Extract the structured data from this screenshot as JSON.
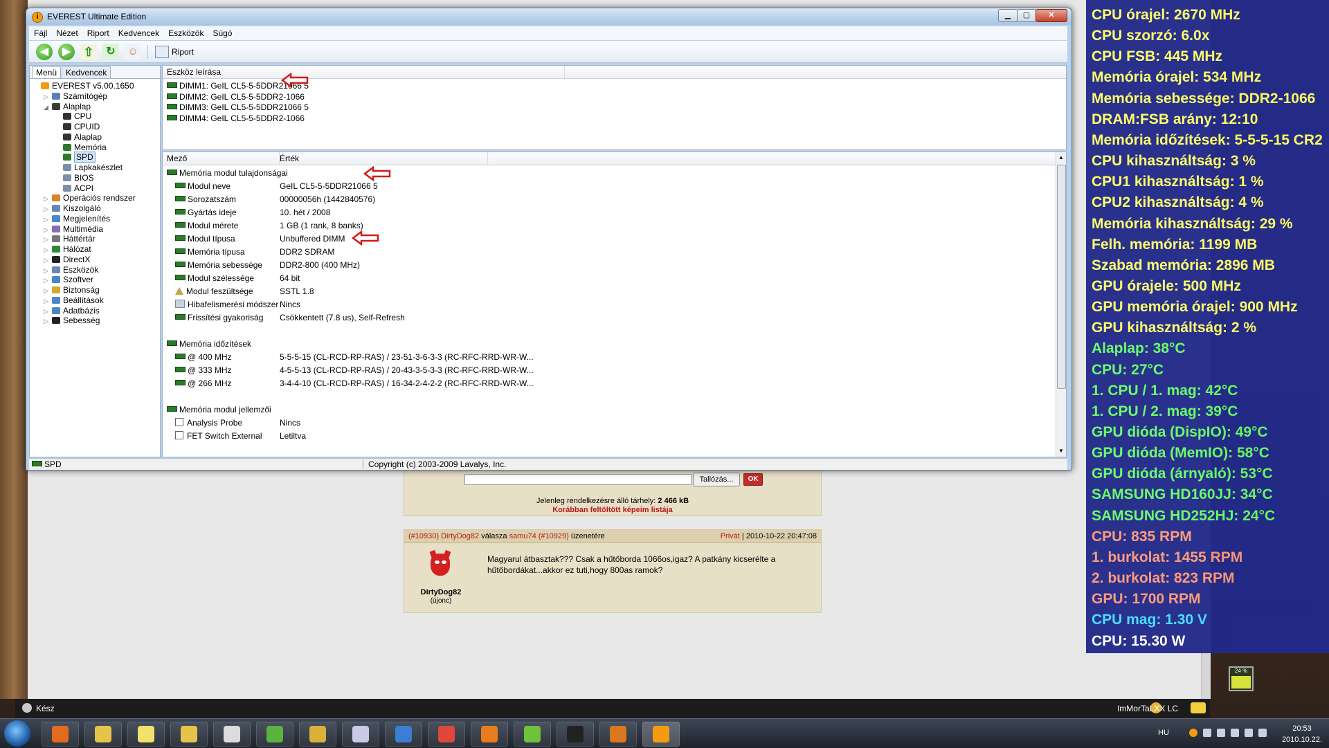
{
  "window": {
    "title": "EVEREST Ultimate Edition",
    "menu": [
      "Fájl",
      "Nézet",
      "Riport",
      "Kedvencek",
      "Eszközök",
      "Súgó"
    ],
    "toolbar": {
      "report_label": "Riport"
    }
  },
  "left_tabs": {
    "menu": "Menü",
    "favorites": "Kedvencek"
  },
  "tree": [
    {
      "label": "EVEREST v5.00.1650",
      "depth": 0,
      "expander": "",
      "icon": "everest-icon",
      "color": "#f39c12"
    },
    {
      "label": "Számítógép",
      "depth": 1,
      "expander": "▷",
      "icon": "computer-icon",
      "color": "#5a7fb8"
    },
    {
      "label": "Alaplap",
      "depth": 1,
      "expander": "◢",
      "icon": "motherboard-icon",
      "color": "#3b3b3b"
    },
    {
      "label": "CPU",
      "depth": 2,
      "expander": "",
      "icon": "cpu-icon",
      "color": "#333333"
    },
    {
      "label": "CPUID",
      "depth": 2,
      "expander": "",
      "icon": "cpuid-icon",
      "color": "#333333"
    },
    {
      "label": "Alaplap",
      "depth": 2,
      "expander": "",
      "icon": "motherboard-icon",
      "color": "#333333"
    },
    {
      "label": "Memória",
      "depth": 2,
      "expander": "",
      "icon": "memory-icon",
      "color": "#2c7a2c"
    },
    {
      "label": "SPD",
      "depth": 2,
      "expander": "",
      "icon": "spd-icon",
      "color": "#2c7a2c",
      "selected": true
    },
    {
      "label": "Lapkakészlet",
      "depth": 2,
      "expander": "",
      "icon": "chipset-icon",
      "color": "#7b8fa8"
    },
    {
      "label": "BIOS",
      "depth": 2,
      "expander": "",
      "icon": "bios-icon",
      "color": "#7b8fa8"
    },
    {
      "label": "ACPI",
      "depth": 2,
      "expander": "",
      "icon": "acpi-icon",
      "color": "#7b8fa8"
    },
    {
      "label": "Operációs rendszer",
      "depth": 1,
      "expander": "▷",
      "icon": "os-icon",
      "color": "#d9822b"
    },
    {
      "label": "Kiszolgáló",
      "depth": 1,
      "expander": "▷",
      "icon": "server-icon",
      "color": "#6b88b5"
    },
    {
      "label": "Megjelenítés",
      "depth": 1,
      "expander": "▷",
      "icon": "display-icon",
      "color": "#4a86c8"
    },
    {
      "label": "Multimédia",
      "depth": 1,
      "expander": "▷",
      "icon": "multimedia-icon",
      "color": "#8a6bb5"
    },
    {
      "label": "Háttértár",
      "depth": 1,
      "expander": "▷",
      "icon": "storage-icon",
      "color": "#777777"
    },
    {
      "label": "Hálózat",
      "depth": 1,
      "expander": "▷",
      "icon": "network-icon",
      "color": "#2a8a3a"
    },
    {
      "label": "DirectX",
      "depth": 1,
      "expander": "▷",
      "icon": "directx-icon",
      "color": "#222222"
    },
    {
      "label": "Eszközök",
      "depth": 1,
      "expander": "▷",
      "icon": "devices-icon",
      "color": "#6b88b5"
    },
    {
      "label": "Szoftver",
      "depth": 1,
      "expander": "▷",
      "icon": "software-icon",
      "color": "#4a86c8"
    },
    {
      "label": "Biztonság",
      "depth": 1,
      "expander": "▷",
      "icon": "security-icon",
      "color": "#d9a62b"
    },
    {
      "label": "Beállítások",
      "depth": 1,
      "expander": "▷",
      "icon": "settings-icon",
      "color": "#4a86c8"
    },
    {
      "label": "Adatbázis",
      "depth": 1,
      "expander": "▷",
      "icon": "database-icon",
      "color": "#4a86c8"
    },
    {
      "label": "Sebesség",
      "depth": 1,
      "expander": "▷",
      "icon": "benchmark-icon",
      "color": "#222222"
    }
  ],
  "device_pane": {
    "header": "Eszköz leírása",
    "items": [
      "DIMM1: GeIL CL5-5-5DDR21066 5",
      "DIMM2: GeIL CL5-5-5DDR2-1066",
      "DIMM3: GeIL CL5-5-5DDR21066 5",
      "DIMM4: GeIL CL5-5-5DDR2-1066"
    ]
  },
  "properties": {
    "col_field": "Mező",
    "col_value": "Érték",
    "sections": [
      {
        "title": "Memória modul tulajdonságai",
        "rows": [
          {
            "field": "Modul neve",
            "value": "GeIL CL5-5-5DDR21066 5",
            "icon": "ram"
          },
          {
            "field": "Sorozatszám",
            "value": "00000056h (1442840576)",
            "icon": "ram"
          },
          {
            "field": "Gyártás ideje",
            "value": "10. hét / 2008",
            "icon": "ram"
          },
          {
            "field": "Modul mérete",
            "value": "1 GB (1 rank, 8 banks)",
            "icon": "ram"
          },
          {
            "field": "Modul típusa",
            "value": "Unbuffered DIMM",
            "icon": "ram"
          },
          {
            "field": "Memória típusa",
            "value": "DDR2 SDRAM",
            "icon": "ram"
          },
          {
            "field": "Memória sebessége",
            "value": "DDR2-800 (400 MHz)",
            "icon": "ram"
          },
          {
            "field": "Modul szélessége",
            "value": "64 bit",
            "icon": "ram"
          },
          {
            "field": "Modul feszültsége",
            "value": "SSTL 1.8",
            "icon": "warning"
          },
          {
            "field": "Hibafelismerési módszer",
            "value": "Nincs",
            "icon": "info"
          },
          {
            "field": "Frissítési gyakoriság",
            "value": "Csökkentett (7.8 us), Self-Refresh",
            "icon": "ram"
          }
        ]
      },
      {
        "title": "Memória időzítések",
        "rows": [
          {
            "field": "@ 400 MHz",
            "value": "5-5-5-15  (CL-RCD-RP-RAS) / 23-51-3-6-3-3  (RC-RFC-RRD-WR-W...",
            "icon": "ram"
          },
          {
            "field": "@ 333 MHz",
            "value": "4-5-5-13  (CL-RCD-RP-RAS) / 20-43-3-5-3-3  (RC-RFC-RRD-WR-W...",
            "icon": "ram"
          },
          {
            "field": "@ 266 MHz",
            "value": "3-4-4-10  (CL-RCD-RP-RAS) / 16-34-2-4-2-2  (RC-RFC-RRD-WR-W...",
            "icon": "ram"
          }
        ]
      },
      {
        "title": "Memória modul jellemzői",
        "rows": [
          {
            "field": "Analysis Probe",
            "value": "Nincs",
            "icon": "checkbox"
          },
          {
            "field": "FET Switch External",
            "value": "Letiltva",
            "icon": "checkbox"
          }
        ]
      }
    ]
  },
  "status_bar": {
    "left": "SPD",
    "copyright": "Copyright (c) 2003-2009 Lavalys, Inc."
  },
  "forum": {
    "browse_label": "Tallózás...",
    "ok_label": "OK",
    "space_text": "Jelenleg rendelkezésre álló tárhely:",
    "space_value": "2 466 kB",
    "prev_images_link": "Korábban feltöltött képeim listája",
    "post": {
      "post_id": "(#10930)",
      "author_link": "DirtyDog82",
      "reply_word": "válasza",
      "reply_to": "samu74",
      "reply_id": "(#10929)",
      "reply_suffix": "üzenetére",
      "private_label": "Privát",
      "datetime": "2010-10-22 20:47:08",
      "username": "DirtyDog82",
      "rank": "(újonc)",
      "text": "Magyarul átbasztak??? Csak a hűtőborda 1066os,igaz? A patkány kicserélte a hűtőbordákat...akkor ez tuti,hogy 800as ramok?"
    }
  },
  "browser_status": {
    "ready": "Kész",
    "user": "ImMorTaLXX LC"
  },
  "sensors": [
    {
      "text": "CPU órajel: 2670 MHz",
      "color": "#ffff66"
    },
    {
      "text": "CPU szorzó: 6.0x",
      "color": "#ffff66"
    },
    {
      "text": "CPU FSB: 445 MHz",
      "color": "#ffff66"
    },
    {
      "text": "Memória órajel: 534 MHz",
      "color": "#ffff66"
    },
    {
      "text": "Memória sebessége: DDR2-1066",
      "color": "#ffff66"
    },
    {
      "text": "DRAM:FSB arány: 12:10",
      "color": "#ffff66"
    },
    {
      "text": "Memória időzítések: 5-5-5-15 CR2",
      "color": "#ffff66"
    },
    {
      "text": "CPU kihasználtság: 3 %",
      "color": "#ffff66"
    },
    {
      "text": "CPU1 kihasználtság: 1 %",
      "color": "#ffff66"
    },
    {
      "text": "CPU2 kihasználtság: 4 %",
      "color": "#ffff66"
    },
    {
      "text": "Memória kihasználtság: 29 %",
      "color": "#ffff66"
    },
    {
      "text": "Felh. memória: 1199 MB",
      "color": "#ffff66"
    },
    {
      "text": "Szabad memória: 2896 MB",
      "color": "#ffff66"
    },
    {
      "text": "GPU órajele: 500 MHz",
      "color": "#ffff66"
    },
    {
      "text": "GPU memória órajel: 900 MHz",
      "color": "#ffff66"
    },
    {
      "text": "GPU kihasználtság: 2 %",
      "color": "#ffff66"
    },
    {
      "text": "Alaplap: 38°C",
      "color": "#66ff66"
    },
    {
      "text": "CPU: 27°C",
      "color": "#66ff66"
    },
    {
      "text": "1. CPU / 1. mag: 42°C",
      "color": "#66ff66"
    },
    {
      "text": "1. CPU / 2. mag: 39°C",
      "color": "#66ff66"
    },
    {
      "text": "GPU dióda (DispIO): 49°C",
      "color": "#66ff66"
    },
    {
      "text": "GPU dióda (MemIO): 58°C",
      "color": "#66ff66"
    },
    {
      "text": "GPU dióda (árnyaló): 53°C",
      "color": "#66ff66"
    },
    {
      "text": "SAMSUNG HD160JJ: 34°C",
      "color": "#66ff66"
    },
    {
      "text": "SAMSUNG HD252HJ: 24°C",
      "color": "#66ff66"
    },
    {
      "text": "CPU: 835 RPM",
      "color": "#ff9977"
    },
    {
      "text": "1. burkolat: 1455 RPM",
      "color": "#ff9977"
    },
    {
      "text": "2. burkolat: 823 RPM",
      "color": "#ff9977"
    },
    {
      "text": "GPU: 1700 RPM",
      "color": "#ff9977"
    },
    {
      "text": "CPU mag: 1.30 V",
      "color": "#44ddff"
    },
    {
      "text": "CPU: 15.30 W",
      "color": "#ffffff"
    }
  ],
  "taskbar": {
    "apps": [
      {
        "name": "media-player",
        "color": "#e46b1e"
      },
      {
        "name": "windows-explorer",
        "color": "#e6c44a"
      },
      {
        "name": "sticky-notes",
        "color": "#f2e16a"
      },
      {
        "name": "file-manager",
        "color": "#e6c44a"
      },
      {
        "name": "xmarks",
        "color": "#dcdcdc"
      },
      {
        "name": "utorrent",
        "color": "#58b33f"
      },
      {
        "name": "tools",
        "color": "#d8b13a"
      },
      {
        "name": "vlc-disc",
        "color": "#c9c9e6"
      },
      {
        "name": "download",
        "color": "#3a7fd4"
      },
      {
        "name": "chrome",
        "color": "#e0473b"
      },
      {
        "name": "firefox",
        "color": "#e97c1e"
      },
      {
        "name": "messenger",
        "color": "#6ec23c"
      },
      {
        "name": "wrc-game",
        "color": "#222222"
      },
      {
        "name": "burning-app",
        "color": "#d9781e"
      },
      {
        "name": "everest",
        "color": "#f39c12"
      }
    ],
    "lang": "HU",
    "time": "20:53",
    "date": "2010.10.22.",
    "meter_pct": "24 %"
  }
}
